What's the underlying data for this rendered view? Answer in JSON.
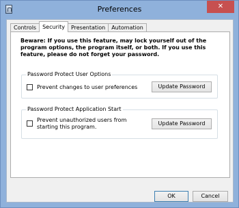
{
  "window": {
    "title": "Preferences",
    "close_label": "✕"
  },
  "tabs": [
    {
      "label": "Controls",
      "active": false
    },
    {
      "label": "Security",
      "active": true
    },
    {
      "label": "Presentation",
      "active": false
    },
    {
      "label": "Automation",
      "active": false
    }
  ],
  "security": {
    "warning": "Beware: If you use this feature, may lock yourself out of the program options, the program itself, or both.  If you use this feature, please do not forget your password.",
    "user_options": {
      "title": "Password Protect User Options",
      "checkbox_label": "Prevent changes to user preferences",
      "checked": false,
      "button_label": "Update Password"
    },
    "app_start": {
      "title": "Password Protect Application Start",
      "checkbox_label": "Prevent unauthorized users from starting this program.",
      "checked": false,
      "button_label": "Update Password"
    }
  },
  "footer": {
    "ok_label": "OK",
    "cancel_label": "Cancel"
  }
}
